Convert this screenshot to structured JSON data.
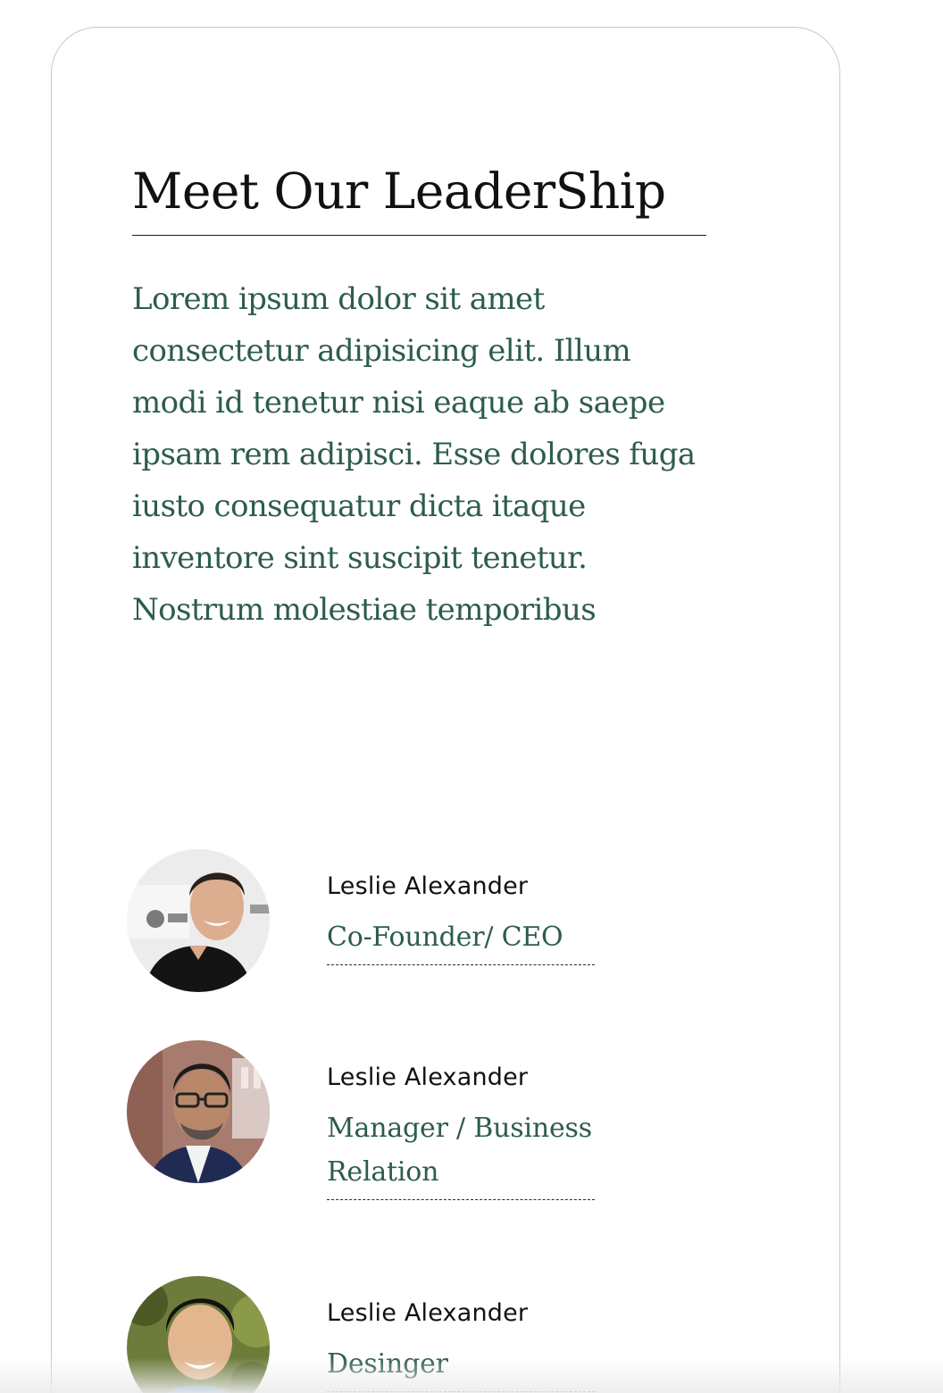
{
  "section": {
    "heading": "Meet Our LeaderShip",
    "intro": "Lorem ipsum dolor sit amet consectetur adipisicing elit. Illum modi id tenetur nisi eaque ab saepe ipsam rem adipisci. Esse dolores fuga iusto consequatur dicta itaque inventore sint suscipit tenetur. Nostrum molestiae temporibus"
  },
  "leaders": [
    {
      "name": "Leslie Alexander",
      "role": "Co-Founder/ CEO"
    },
    {
      "name": "Leslie Alexander",
      "role": "Manager / Business Relation"
    },
    {
      "name": "Leslie Alexander",
      "role": "Desinger"
    }
  ],
  "colors": {
    "accent_text": "#2d5c4d",
    "heading_text": "#111111",
    "card_border": "#c9c9c9"
  }
}
